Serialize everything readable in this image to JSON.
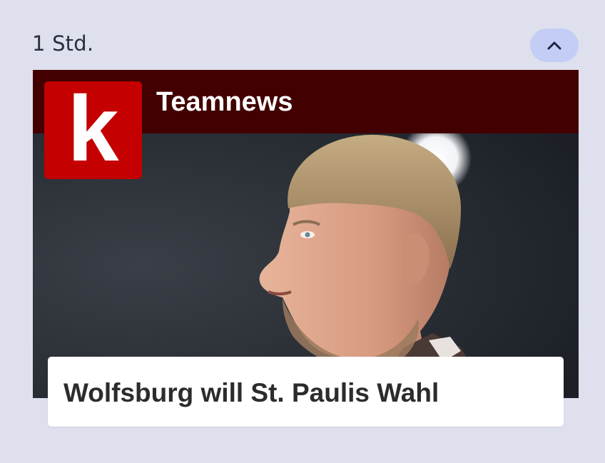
{
  "timestamp": "1 Std.",
  "collapse_button": {
    "icon": "chevron-up-icon"
  },
  "card": {
    "source": "Teamnews",
    "logo_letter": "k",
    "headline": "Wolfsburg will St. Paulis Wahl",
    "colors": {
      "header_bg": "#420000",
      "logo_bg": "#c40000",
      "page_bg": "#dfe0ee",
      "button_bg": "#c3cdf6"
    }
  }
}
